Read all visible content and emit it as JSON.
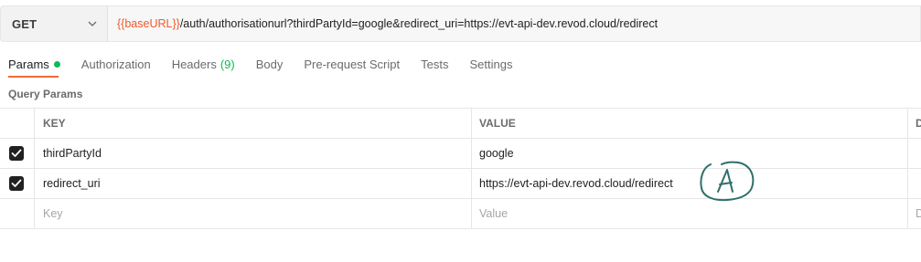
{
  "request": {
    "method": "GET",
    "url_variable": "{{baseURL}}",
    "url_path": "/auth/authorisationurl?thirdPartyId=google&redirect_uri=https://evt-api-dev.revod.cloud/redirect"
  },
  "tabs": [
    {
      "label": "Params",
      "active": true
    },
    {
      "label": "Authorization"
    },
    {
      "label": "Headers",
      "count": "(9)"
    },
    {
      "label": "Body"
    },
    {
      "label": "Pre-request Script"
    },
    {
      "label": "Tests"
    },
    {
      "label": "Settings"
    }
  ],
  "section_title": "Query Params",
  "table": {
    "headers": {
      "key": "KEY",
      "value": "VALUE",
      "description": "D"
    },
    "rows": [
      {
        "key": "thirdPartyId",
        "value": "google",
        "checked": true
      },
      {
        "key": "redirect_uri",
        "value": "https://evt-api-dev.revod.cloud/redirect",
        "checked": true
      }
    ],
    "empty_row": {
      "key_placeholder": "Key",
      "value_placeholder": "Value",
      "desc_placeholder": "D"
    }
  },
  "annotation": {
    "letter": "A",
    "color": "#2e6f6a"
  },
  "colors": {
    "accent": "#f26b3a",
    "status_green": "#0cbb52",
    "variable": "#f05a28"
  }
}
